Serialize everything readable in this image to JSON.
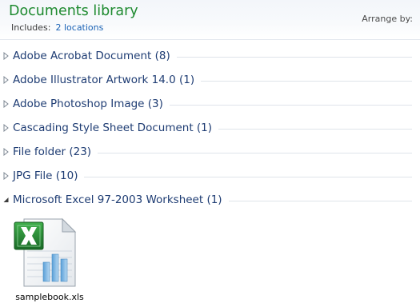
{
  "library": {
    "title": "Documents library",
    "includes_label": "Includes:",
    "locations_link": "2 locations",
    "arrange_label": "Arrange by:"
  },
  "groups": [
    {
      "label": "Adobe Acrobat Document (8)",
      "expanded": false
    },
    {
      "label": "Adobe Illustrator Artwork 14.0 (1)",
      "expanded": false
    },
    {
      "label": "Adobe Photoshop Image (3)",
      "expanded": false
    },
    {
      "label": "Cascading Style Sheet Document (1)",
      "expanded": false
    },
    {
      "label": "File folder (23)",
      "expanded": false
    },
    {
      "label": "JPG File (10)",
      "expanded": false
    },
    {
      "label": "Microsoft Excel 97-2003 Worksheet (1)",
      "expanded": true
    }
  ],
  "files": [
    {
      "name": "samplebook.xls",
      "icon": "excel-file-icon"
    }
  ],
  "colors": {
    "title_green": "#1e8a2f",
    "link_blue": "#1a62b5",
    "group_text": "#1e3c73",
    "excel_green": "#1e7a2e"
  }
}
